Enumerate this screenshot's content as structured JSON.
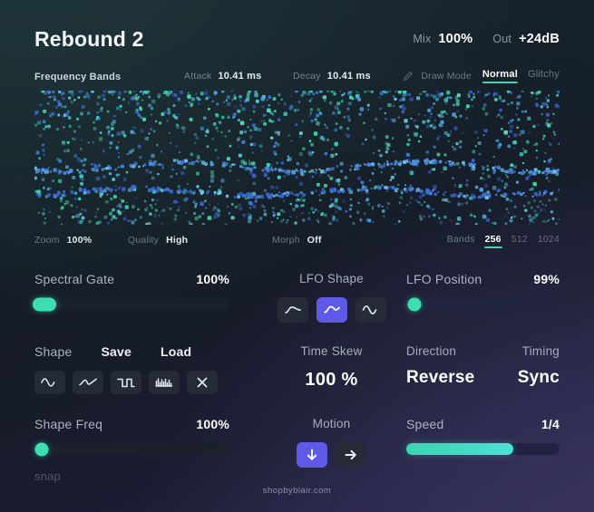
{
  "header": {
    "title": "Rebound 2",
    "mix_label": "Mix",
    "mix_value": "100%",
    "out_label": "Out",
    "out_value": "+24dB"
  },
  "subheader": {
    "section_title": "Frequency Bands",
    "attack_label": "Attack",
    "attack_value": "10.41 ms",
    "decay_label": "Decay",
    "decay_value": "10.41 ms",
    "draw_mode_label": "Draw Mode",
    "modes": [
      {
        "label": "Normal",
        "active": true
      },
      {
        "label": "Glitchy",
        "active": false
      }
    ]
  },
  "spectrum_footer": {
    "zoom_label": "Zoom",
    "zoom_value": "100%",
    "quality_label": "Quality",
    "quality_value": "High",
    "morph_label": "Morph",
    "morph_value": "Off",
    "bands_label": "Bands",
    "bands_options": [
      {
        "label": "256",
        "active": true
      },
      {
        "label": "512",
        "active": false
      },
      {
        "label": "1024",
        "active": false
      }
    ]
  },
  "controls": {
    "spectral_gate": {
      "label": "Spectral Gate",
      "value": "100%"
    },
    "lfo_shape": {
      "label": "LFO Shape",
      "buttons": [
        {
          "icon": "wave-curve-icon",
          "active": false
        },
        {
          "icon": "wave-ramp-icon",
          "active": true
        },
        {
          "icon": "wave-sine-icon",
          "active": false
        }
      ]
    },
    "lfo_position": {
      "label": "LFO Position",
      "value": "99%"
    },
    "shape": {
      "label": "Shape",
      "save_label": "Save",
      "load_label": "Load",
      "buttons": [
        {
          "icon": "sine-wave-icon"
        },
        {
          "icon": "smooth-saw-icon"
        },
        {
          "icon": "square-wave-icon"
        },
        {
          "icon": "noise-wave-icon"
        },
        {
          "icon": "clear-x-icon"
        }
      ]
    },
    "time_skew": {
      "label": "Time Skew",
      "value": "100 %"
    },
    "direction": {
      "label": "Direction",
      "value": "Reverse"
    },
    "timing": {
      "label": "Timing",
      "value": "Sync"
    },
    "shape_freq": {
      "label": "Shape Freq",
      "value": "100%",
      "snap_label": "snap"
    },
    "motion": {
      "label": "Motion",
      "buttons": [
        {
          "icon": "arrow-down-icon",
          "active": true
        },
        {
          "icon": "arrow-right-icon",
          "active": false
        }
      ]
    },
    "speed": {
      "label": "Speed",
      "value": "1/4"
    }
  },
  "footer": {
    "text": "shopbyblair.com"
  },
  "colors": {
    "accent_teal": "#3ddfb1",
    "accent_cyan": "#4de0d5",
    "accent_purple": "#5e5ae8",
    "text_primary": "#ffffff",
    "text_muted": "#6e7a87"
  }
}
